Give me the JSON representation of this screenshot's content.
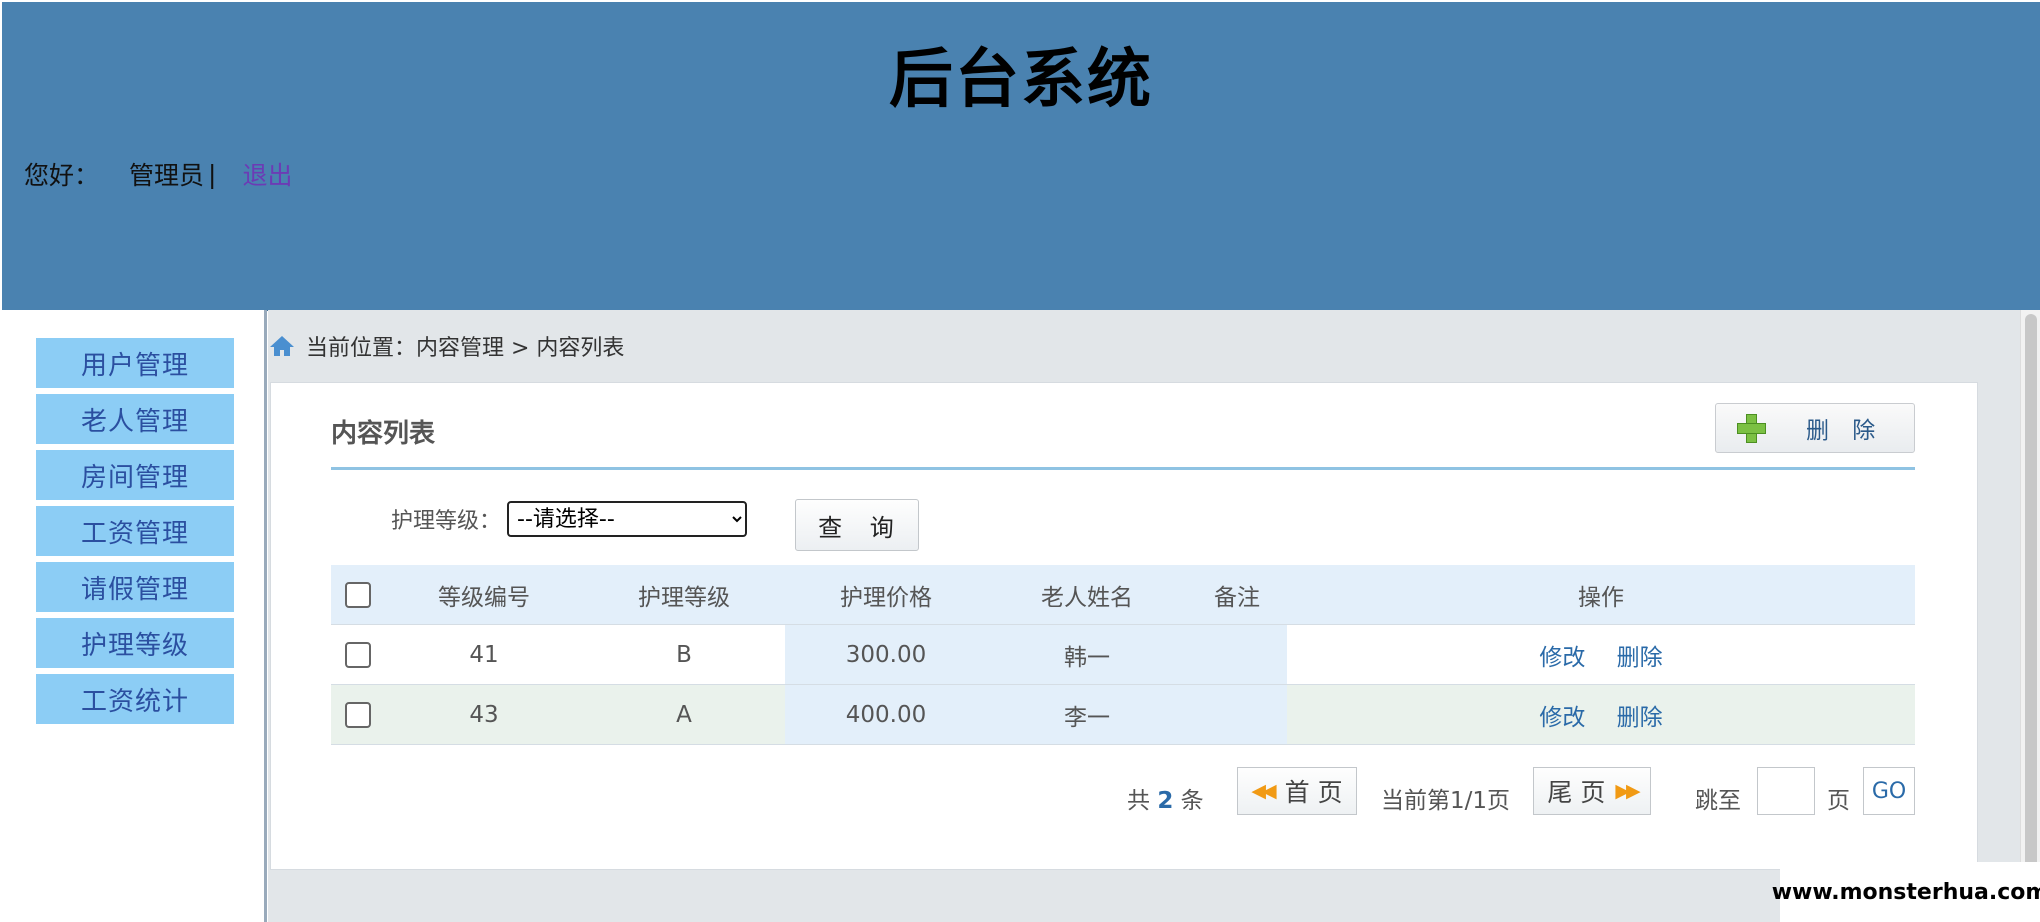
{
  "header": {
    "title": "后台系统",
    "greeting": "您好：",
    "user": "管理员",
    "separator": "|",
    "logout": "退出"
  },
  "sidebar": {
    "items": [
      {
        "label": "用户管理"
      },
      {
        "label": "老人管理"
      },
      {
        "label": "房间管理"
      },
      {
        "label": "工资管理"
      },
      {
        "label": "请假管理"
      },
      {
        "label": "护理等级"
      },
      {
        "label": "工资统计"
      }
    ]
  },
  "breadcrumb": {
    "icon": "home-icon",
    "text": "当前位置：内容管理 > 内容列表"
  },
  "panel": {
    "title": "内容列表",
    "delete_button": "删 除",
    "filter_label": "护理等级：",
    "filter_selected": "--请选择--",
    "query_button": "查 询"
  },
  "table": {
    "headers": [
      "等级编号",
      "护理等级",
      "护理价格",
      "老人姓名",
      "备注",
      "操作"
    ],
    "rows": [
      {
        "id": "41",
        "level": "B",
        "price": "300.00",
        "name": "韩一",
        "note": "",
        "edit": "修改",
        "delete": "删除"
      },
      {
        "id": "43",
        "level": "A",
        "price": "400.00",
        "name": "李一",
        "note": "",
        "edit": "修改",
        "delete": "删除"
      }
    ]
  },
  "pagination": {
    "total_prefix": "共",
    "total_count": "2",
    "total_suffix": "条",
    "first": "首 页",
    "page_info": "当前第1/1页",
    "last": "尾 页",
    "jump_label": "跳至",
    "page_unit": "页",
    "go": "GO"
  },
  "watermark": "www.monsterhua.com",
  "colors": {
    "header_bg": "#4a82b0",
    "sidebar_item_bg": "#8ccdf5",
    "sidebar_item_text": "#2b4fa0",
    "link": "#2a6aa8"
  }
}
